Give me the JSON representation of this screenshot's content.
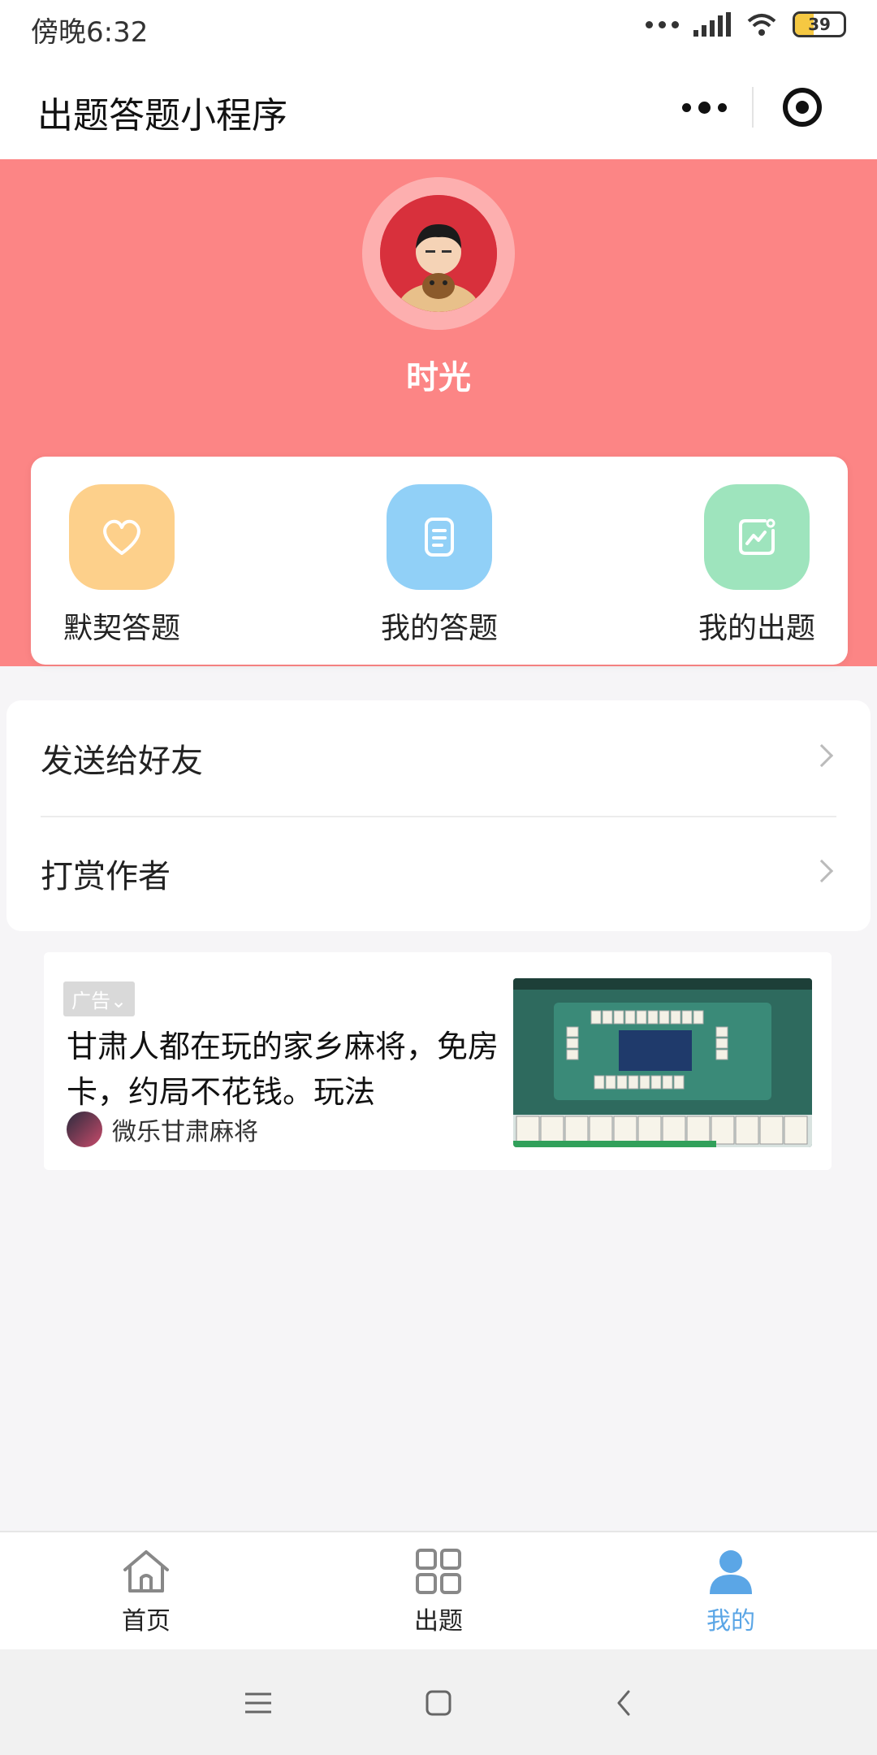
{
  "status_bar": {
    "time": "傍晚6:32",
    "battery": "39",
    "battery_level": 0.39
  },
  "nav_bar": {
    "title": "出题答题小程序"
  },
  "profile": {
    "username": "时光"
  },
  "quick_actions": [
    {
      "label": "默契答题",
      "icon": "heart-icon",
      "color": "#fdd08b"
    },
    {
      "label": "我的答题",
      "icon": "document-icon",
      "color": "#91d0f7"
    },
    {
      "label": "我的出题",
      "icon": "image-edit-icon",
      "color": "#9ee4bd"
    }
  ],
  "menu": [
    {
      "label": "发送给好友"
    },
    {
      "label": "打赏作者"
    }
  ],
  "ad": {
    "badge": "广告⌄",
    "text": "甘肃人都在玩的家乡麻将，免房卡，约局不花钱。玩法",
    "brand": "微乐甘肃麻将"
  },
  "tab_bar": [
    {
      "label": "首页",
      "icon": "home-icon",
      "active": false
    },
    {
      "label": "出题",
      "icon": "grid-icon",
      "active": false
    },
    {
      "label": "我的",
      "icon": "user-icon",
      "active": true
    }
  ],
  "colors": {
    "header": "#fc8585",
    "active_tab": "#5ba6e6"
  }
}
